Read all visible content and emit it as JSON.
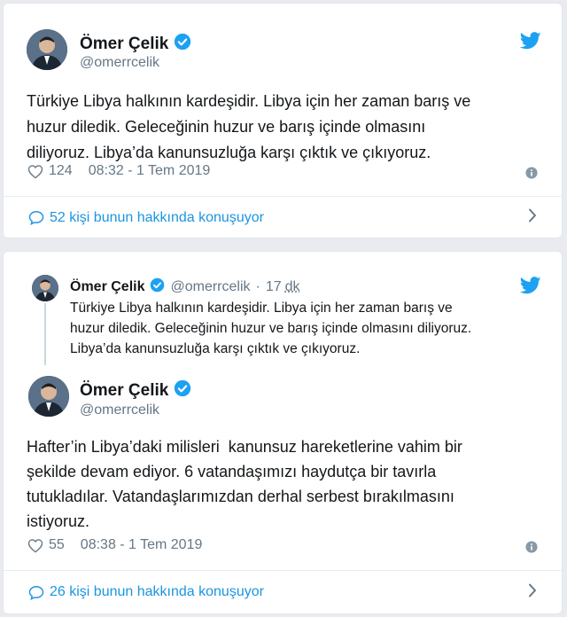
{
  "tweet1": {
    "author_name": "Ömer Çelik",
    "handle": "@omerrcelik",
    "text": "Türkiye Libya halkının kardeşidir. Libya için her zaman barış ve\nhuzur diledik. Geleceğinin huzur ve barış içinde olmasını\ndiliyoruz. Libya’da kanunsuzluğa karşı çıktık ve çıkıyoruz.",
    "likes": "124",
    "timestamp": "08:32 - 1 Tem 2019",
    "conversation": "52 kişi bunun hakkında konuşuyor"
  },
  "tweet2": {
    "quoted": {
      "author_name": "Ömer Çelik",
      "handle": "@omerrcelik",
      "separator": "·",
      "age_num": "17",
      "age_unit": "dk",
      "text": "Türkiye Libya halkının kardeşidir. Libya için her zaman barış ve\nhuzur diledik. Geleceğinin huzur ve barış içinde olmasını diliyoruz.\nLibya’da kanunsuzluğa karşı çıktık ve çıkıyoruz."
    },
    "author_name": "Ömer Çelik",
    "handle": "@omerrcelik",
    "text": "Hafter’in Libya’daki milisleri  kanunsuz hareketlerine vahim bir\nşekilde devam ediyor. 6 vatandaşımızı haydutça bir tavırla\ntutukladılar. Vatandaşlarımızdan derhal serbest bırakılmasını\nistiyoruz.",
    "likes": "55",
    "timestamp": "08:38 - 1 Tem 2019",
    "conversation": "26 kişi bunun hakkında konuşuyor"
  },
  "colors": {
    "twitter_blue": "#1da1f2",
    "link_blue": "#1b95e0",
    "text": "#14171a",
    "muted": "#657786"
  },
  "icons": [
    "twitter-bird-icon",
    "verified-badge-icon",
    "heart-icon",
    "info-icon",
    "speech-bubble-icon",
    "chevron-right-icon"
  ]
}
